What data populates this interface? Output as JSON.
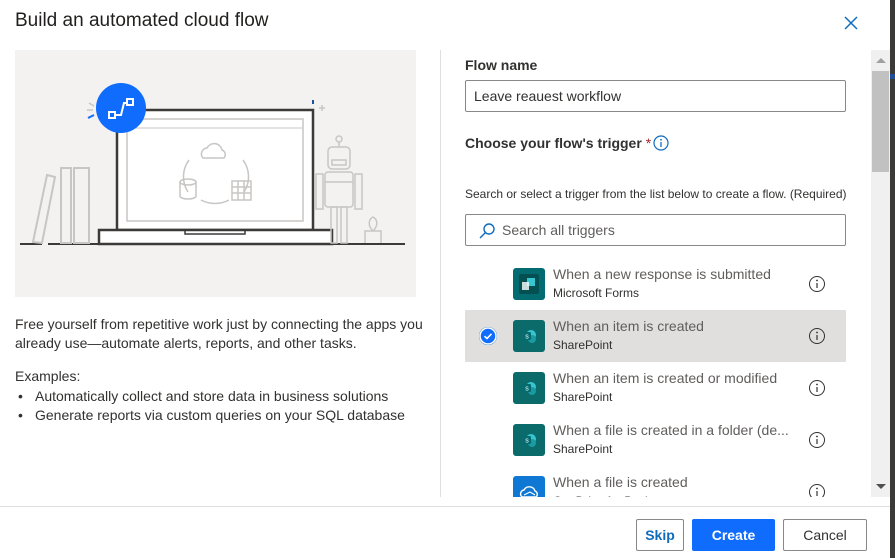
{
  "dialog": {
    "title": "Build an automated cloud flow",
    "close_icon": "close-icon"
  },
  "left": {
    "illustration": "laptop-flow-illustration",
    "description": "Free yourself from repetitive work just by connecting the apps you already use—automate alerts, reports, and other tasks.",
    "examples_label": "Examples:",
    "examples": [
      "Automatically collect and store data in business solutions",
      "Generate reports via custom queries on your SQL database"
    ]
  },
  "form": {
    "flow_name_label": "Flow name",
    "flow_name_value": "Leave reauest workflow",
    "trigger_label": "Choose your flow's trigger",
    "required_mark": "*",
    "hint": "Search or select a trigger from the list below to create a flow. (Required)",
    "search_placeholder": "Search all triggers"
  },
  "triggers": [
    {
      "title": "When a new response is submitted",
      "connector": "Microsoft Forms",
      "icon": "forms-icon",
      "color": "#036c70",
      "selected": false
    },
    {
      "title": "When an item is created",
      "connector": "SharePoint",
      "icon": "sharepoint-icon",
      "color": "#0b6a6a",
      "selected": true
    },
    {
      "title": "When an item is created or modified",
      "connector": "SharePoint",
      "icon": "sharepoint-icon",
      "color": "#0b6a6a",
      "selected": false
    },
    {
      "title": "When a file is created in a folder (de...",
      "connector": "SharePoint",
      "icon": "sharepoint-icon",
      "color": "#0b6a6a",
      "selected": false
    },
    {
      "title": "When a file is created",
      "connector": "OneDrive for Business",
      "icon": "onedrive-icon",
      "color": "#0f78d4",
      "selected": false
    }
  ],
  "footer": {
    "skip": "Skip",
    "create": "Create",
    "cancel": "Cancel"
  },
  "colors": {
    "accent": "#0f6cfd",
    "selected_row": "#e1dfdd"
  }
}
